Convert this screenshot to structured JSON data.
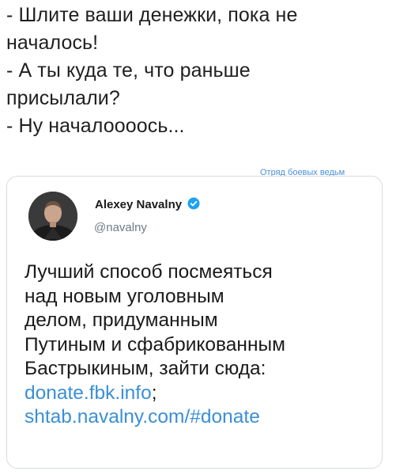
{
  "dialog": {
    "lines": [
      "- Шлите ваши денежки, пока не",
      "началось!",
      "- А ты куда те, что раньше",
      "присылали?",
      "- Ну началоооось..."
    ]
  },
  "watermark": "Отряд боевых ведьм",
  "tweet": {
    "author_name": "Alexey Navalny",
    "author_handle": "@navalny",
    "verified_icon": "verified-check-icon",
    "text_lines": [
      "Лучший способ посмеяться",
      "над новым уголовным",
      "делом, придуманным",
      "Путиным и сфабрикованным",
      "Бастрыкиным, зайти сюда:"
    ],
    "link1": "donate.fbk.info",
    "link1_suffix": ";",
    "link2": "shtab.navalny.com/#donate"
  },
  "colors": {
    "link": "#3a8fd6",
    "verified": "#1da1f2",
    "handle": "#6e7b87",
    "border": "#d6dde3"
  }
}
